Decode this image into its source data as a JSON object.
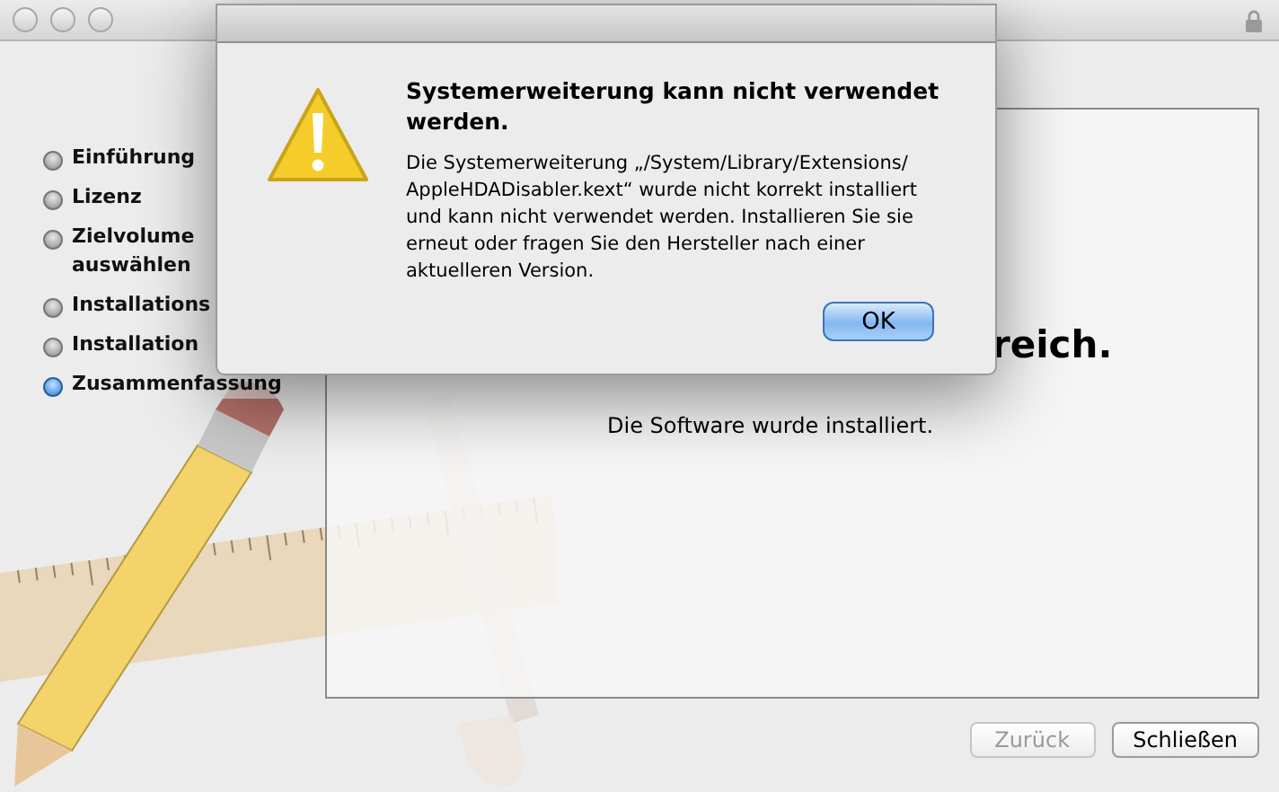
{
  "window": {
    "locked": true
  },
  "sidebar": {
    "items": [
      {
        "label": "Einführung",
        "selected": false
      },
      {
        "label": "Lizenz",
        "selected": false
      },
      {
        "label": "Zielvolume auswählen",
        "selected": false
      },
      {
        "label": "Installations",
        "selected": false
      },
      {
        "label": "Installation",
        "selected": false
      },
      {
        "label": "Zusammenfassung",
        "selected": true
      }
    ]
  },
  "content": {
    "heading": "reich.",
    "message": "Die Software wurde installiert."
  },
  "buttons": [
    {
      "label": "Zurück",
      "disabled": true
    },
    {
      "label": "Schließen",
      "disabled": false
    }
  ],
  "alert": {
    "title": "Systemerweiterung kann nicht verwendet werden.",
    "message": "Die Systemerweiterung „/System/Library/Extensions/ AppleHDADisabler.kext“ wurde nicht korrekt installiert und kann nicht verwendet werden. Installieren Sie sie erneut oder fragen Sie den Hersteller nach einer aktuelleren Version.",
    "button": "OK"
  }
}
